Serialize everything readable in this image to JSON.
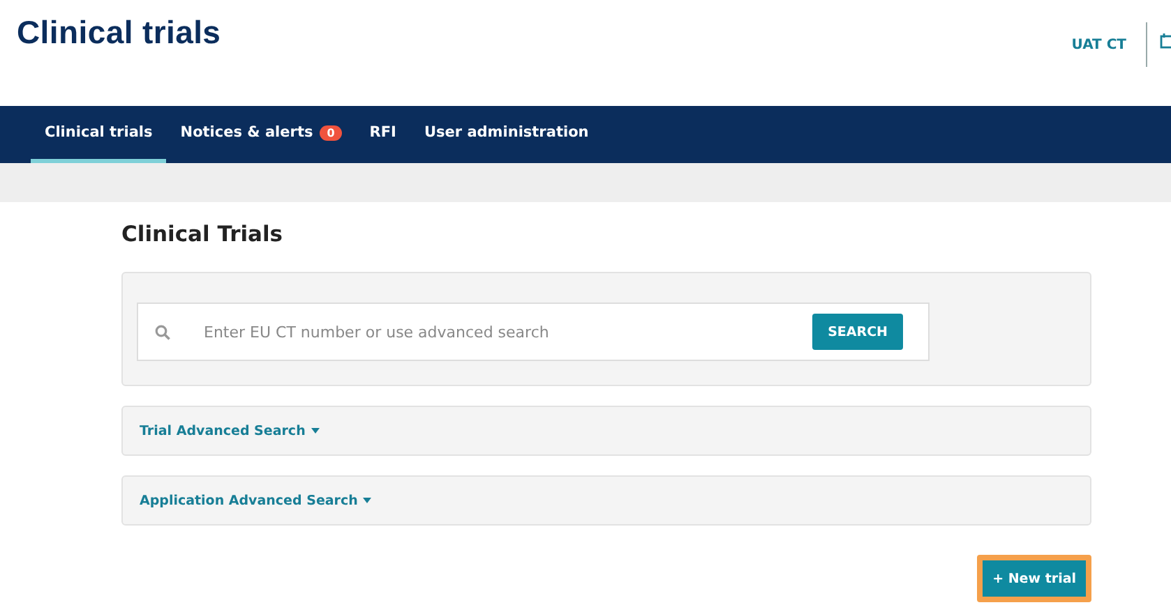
{
  "header": {
    "title": "Clinical trials",
    "user": "UAT CT"
  },
  "nav": [
    {
      "label": "Clinical trials",
      "selected": true
    },
    {
      "label": "Notices & alerts",
      "selected": false,
      "badge": "0"
    },
    {
      "label": "RFI",
      "selected": false
    },
    {
      "label": "User administration",
      "selected": false
    }
  ],
  "page_title": "Clinical Trials",
  "search": {
    "placeholder": "Enter EU CT number or use advanced search",
    "button": "SEARCH"
  },
  "sections": [
    {
      "label": "Trial Advanced Search",
      "expanded": false
    },
    {
      "label": "Application Advanced Search",
      "expanded": false
    }
  ],
  "new_trial": {
    "label": "+ New trial",
    "highlighted": true
  }
}
